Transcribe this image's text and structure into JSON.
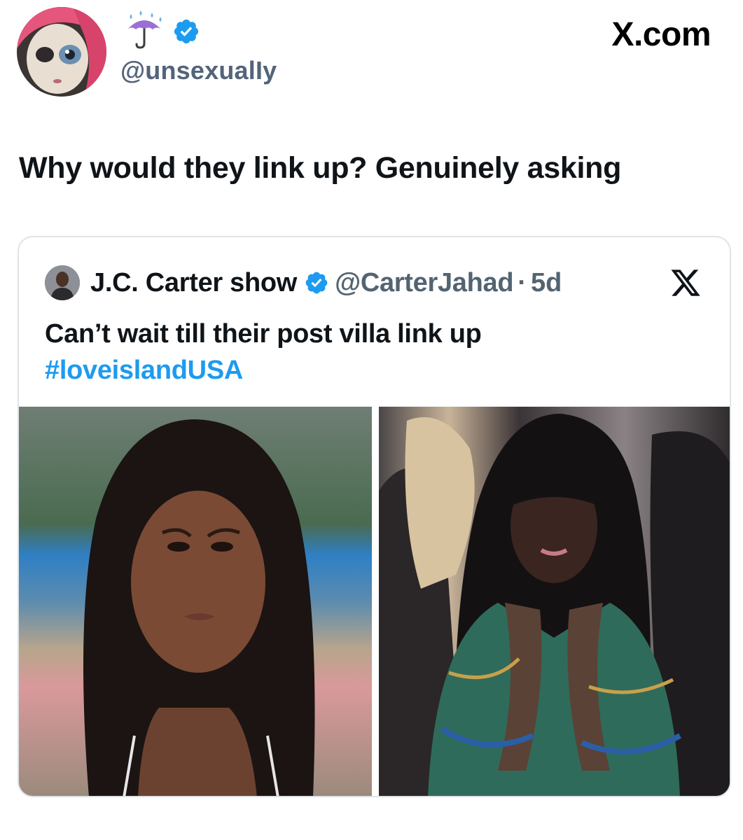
{
  "author": {
    "handle": "@unsexualIy",
    "verified": true,
    "display_emoji": "umbrella-with-rain-icon",
    "avatar": "pink-haired-doll-avatar"
  },
  "brand": "X.com",
  "tweet": {
    "text": "Why would they link up? Genuinely asking"
  },
  "quoted": {
    "name": "J.C. Carter show",
    "verified": true,
    "handle": "@CarterJahad",
    "separator": "·",
    "time": "5d",
    "text": "Can’t wait till their post villa link up",
    "hashtag": "#loveislandUSA",
    "images": [
      "portrait-photo-left",
      "portrait-photo-right"
    ]
  },
  "colors": {
    "accent": "#1d9bf0",
    "secondary_text": "#536471",
    "border": "#dfe3e7"
  }
}
